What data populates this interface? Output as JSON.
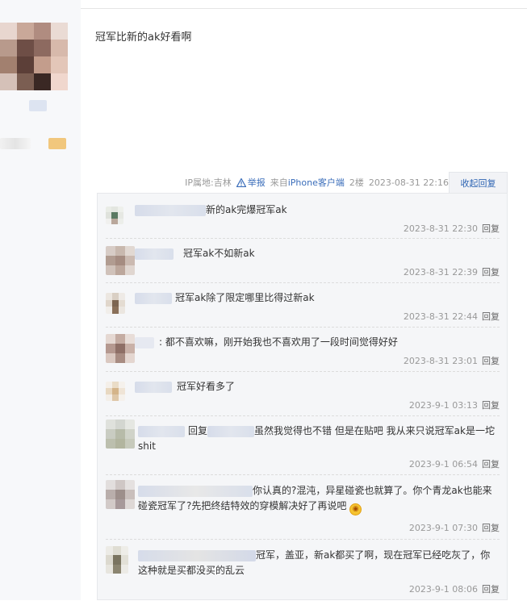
{
  "post": {
    "content": "冠军比新的ak好看啊",
    "meta": {
      "ip": "IP属地:吉林",
      "report_label": "举报",
      "from_prefix": "来自",
      "from_client": "iPhone客户端",
      "floor": "2楼",
      "time": "2023-08-31 22:16"
    },
    "collapse_label": "收起回复"
  },
  "replies": [
    {
      "text": "新的ak完爆冠军ak",
      "time": "2023-8-31 22:30",
      "reply": "回复"
    },
    {
      "text": "冠军ak不如新ak",
      "time": "2023-8-31 22:39",
      "reply": "回复"
    },
    {
      "text": "冠军ak除了限定哪里比得过新ak",
      "time": "2023-8-31 22:44",
      "reply": "回复"
    },
    {
      "text": ": 都不喜欢嘛，刚开始我也不喜欢用了一段时间觉得好好",
      "time": "2023-8-31 23:01",
      "reply": "回复"
    },
    {
      "text": "冠军好看多了",
      "time": "2023-9-1 03:13",
      "reply": "回复"
    },
    {
      "text_prefix": "回复",
      "text": "虽然我觉得也不错 但是在贴吧 我从来只说冠军ak是一坨shit",
      "time": "2023-9-1 06:54",
      "reply": "回复"
    },
    {
      "text": "你认真的?混沌，异星碰瓷也就算了。你个青龙ak也能来碰瓷冠军了?先把终结特效的穿模解决好了再说吧",
      "time": "2023-9-1 07:30",
      "reply": "回复"
    },
    {
      "text": "冠军，盖亚，新ak都买了啊，现在冠军已经吃灰了，你这种就是买都没买的乱云",
      "time": "2023-9-1 08:06",
      "reply": "回复"
    }
  ]
}
